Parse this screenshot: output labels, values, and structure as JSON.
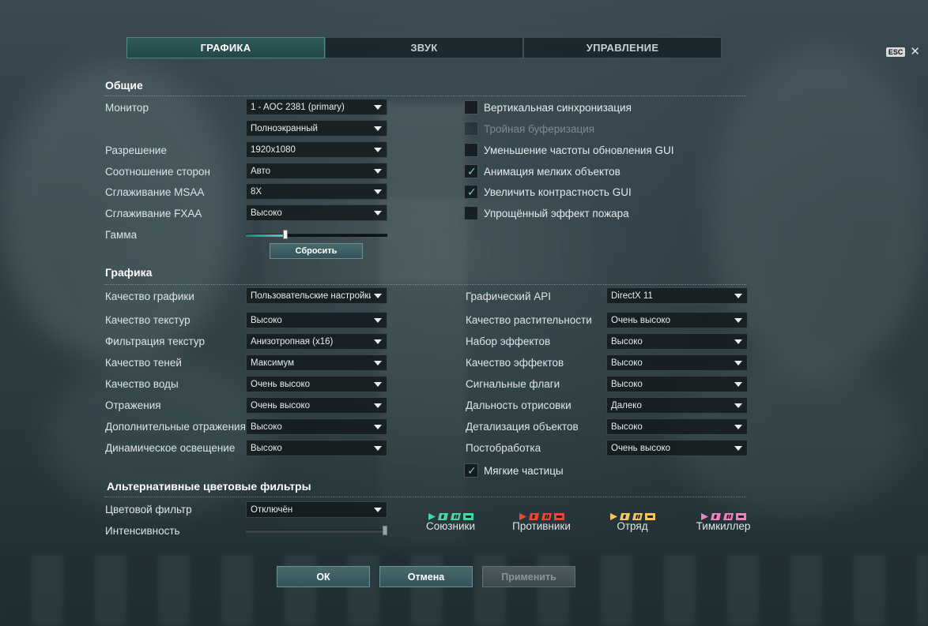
{
  "tabs": [
    {
      "label": "ГРАФИКА",
      "active": true
    },
    {
      "label": "ЗВУК",
      "active": false
    },
    {
      "label": "УПРАВЛЕНИЕ",
      "active": false
    }
  ],
  "esc": {
    "key": "ESC",
    "close": "✕"
  },
  "general": {
    "title": "Общие",
    "monitor_label": "Монитор",
    "monitor_value": "1 - AOC 2381 (primary)",
    "mode_value": "Полноэкранный",
    "resolution_label": "Разрешение",
    "resolution_value": "1920x1080",
    "aspect_label": "Соотношение сторон",
    "aspect_value": "Авто",
    "msaa_label": "Сглаживание MSAA",
    "msaa_value": "8X",
    "fxaa_label": "Сглаживание FXAA",
    "fxaa_value": "Высоко",
    "gamma_label": "Гамма",
    "gamma_level": 0.28,
    "reset_label": "Сбросить",
    "checkboxes": [
      {
        "label": "Вертикальная синхронизация",
        "checked": false,
        "disabled": false
      },
      {
        "label": "Тройная буферизация",
        "checked": false,
        "disabled": true
      },
      {
        "label": "Уменьшение частоты обновления GUI",
        "checked": false,
        "disabled": false
      },
      {
        "label": "Анимация мелких объектов",
        "checked": true,
        "disabled": false
      },
      {
        "label": "Увеличить контрастность GUI",
        "checked": true,
        "disabled": false
      },
      {
        "label": "Упрощённый эффект пожара",
        "checked": false,
        "disabled": false
      }
    ]
  },
  "graphics": {
    "title": "Графика",
    "left": [
      {
        "label": "Качество графики",
        "value": "Пользовательские настройки"
      },
      {
        "label": "Качество текстур",
        "value": "Высоко"
      },
      {
        "label": "Фильтрация текстур",
        "value": "Анизотропная (x16)"
      },
      {
        "label": "Качество теней",
        "value": "Максимум"
      },
      {
        "label": "Качество воды",
        "value": "Очень высоко"
      },
      {
        "label": "Отражения",
        "value": "Очень высоко"
      },
      {
        "label": "Дополнительные отражения",
        "value": "Высоко"
      },
      {
        "label": "Динамическое освещение",
        "value": "Высоко"
      }
    ],
    "right": [
      {
        "label": "Графический API",
        "value": "DirectX 11"
      },
      {
        "label": "Качество растительности",
        "value": "Очень высоко"
      },
      {
        "label": "Набор эффектов",
        "value": "Высоко"
      },
      {
        "label": "Качество эффектов",
        "value": "Высоко"
      },
      {
        "label": "Сигнальные флаги",
        "value": "Высоко"
      },
      {
        "label": "Дальность отрисовки",
        "value": "Далеко"
      },
      {
        "label": "Детализация объектов",
        "value": "Высоко"
      },
      {
        "label": "Постобработка",
        "value": "Очень высоко"
      }
    ],
    "soft_particles_label": "Мягкие частицы",
    "soft_particles_checked": true
  },
  "filters": {
    "title": "Альтернативные цветовые фильтры",
    "filter_label": "Цветовой фильтр",
    "filter_value": "Отключён",
    "intensity_label": "Интенсивность",
    "intensity_level": 1.0,
    "legend": [
      {
        "label": "Союзники",
        "color": "#45d6a0"
      },
      {
        "label": "Противники",
        "color": "#f0462e"
      },
      {
        "label": "Отряд",
        "color": "#f3c45a"
      },
      {
        "label": "Тимкиллер",
        "color": "#f07fbf"
      }
    ]
  },
  "buttons": {
    "ok": "ОК",
    "cancel": "Отмена",
    "apply": "Применить"
  }
}
